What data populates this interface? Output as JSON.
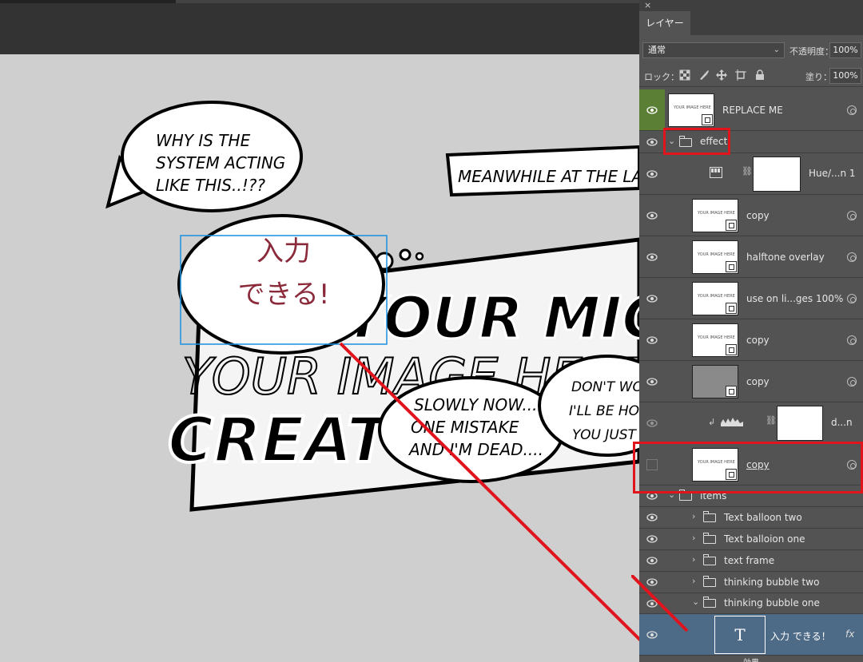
{
  "panel": {
    "close_glyph": "×",
    "tab_label": "レイヤー",
    "blend_mode": "通常",
    "opacity_label": "不透明度：",
    "opacity_value": "100%",
    "lock_label": "ロック：",
    "fill_label": "塗り：",
    "fill_value": "100%"
  },
  "layers": {
    "replace_me": "REPLACE ME",
    "effect": "effect",
    "hue": "Hue/...n 1",
    "copy1": "copy",
    "halftone": "halftone overlay",
    "use_on": "use on li...ges 100%",
    "copy2": "copy",
    "copy3": "copy",
    "dn": "d...n",
    "copy4": "copy",
    "items": "items",
    "text_balloon_two": "Text balloon two",
    "text_balloon_one": "Text balloion one",
    "text_frame": "text frame",
    "thinking_two": "thinking bubble two",
    "thinking_one": "thinking bubble one",
    "text_layer": "入力 できる！",
    "fx": "fx",
    "effects_label": "効果",
    "thumb_mini": "YOUR IMAGE HERE",
    "text_thumb_glyph": "T"
  },
  "canvas": {
    "bubble1_line1": "WHY IS THE",
    "bubble1_line2": "SYSTEM ACTING",
    "bubble1_line3": "LIKE THIS..!??",
    "meanwhile": "MEANWHILE AT THE LA",
    "japanese_line1": "入力",
    "japanese_line2": "できる!",
    "your_image": "YOUR IMAGE HERE",
    "headline_top": "YOUR MIC SCEN",
    "headline_bottom": "CREAT",
    "slowly_line1": "SLOWLY NOW...",
    "slowly_line2": "ONE MISTAKE",
    "slowly_line3": "AND I'M DEAD....",
    "dont_line1": "DON'T WOR",
    "dont_line2": "I'LL BE HOM",
    "dont_line3": "YOU JUST T"
  },
  "colors": {
    "highlight": "#e0141c",
    "selection_blue": "#1a8fe0",
    "japanese_text": "#8a2a3a",
    "selected_row": "#4d6a87",
    "green_eye": "#5a7f35"
  }
}
